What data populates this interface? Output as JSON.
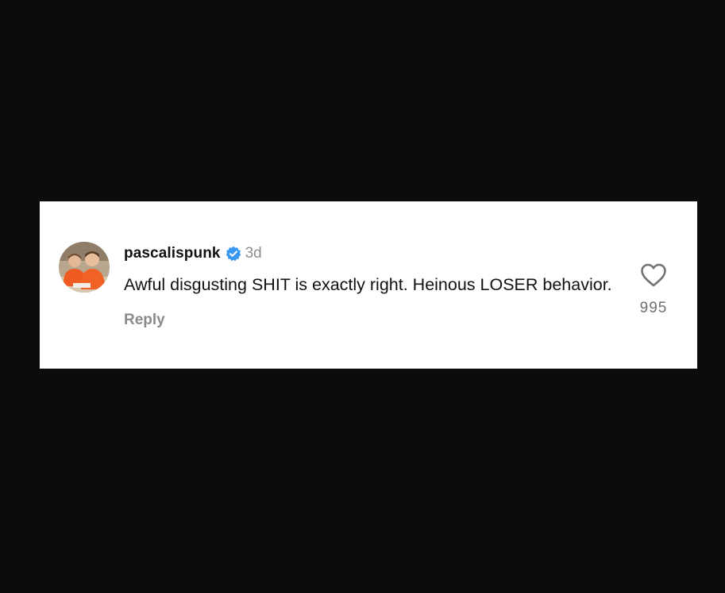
{
  "comment": {
    "username": "pascalispunk",
    "verified_icon": "verified-badge-icon",
    "verified_color": "#3897f0",
    "timestamp": "3d",
    "text": "Awful disgusting SHIT is exactly right. Heinous LOSER behavior.",
    "reply_label": "Reply",
    "like_icon": "heart-outline-icon",
    "like_count": "995"
  },
  "colors": {
    "background": "#0c0c0c",
    "card": "#ffffff",
    "text_primary": "#111111",
    "text_secondary": "#8e8e8e"
  }
}
